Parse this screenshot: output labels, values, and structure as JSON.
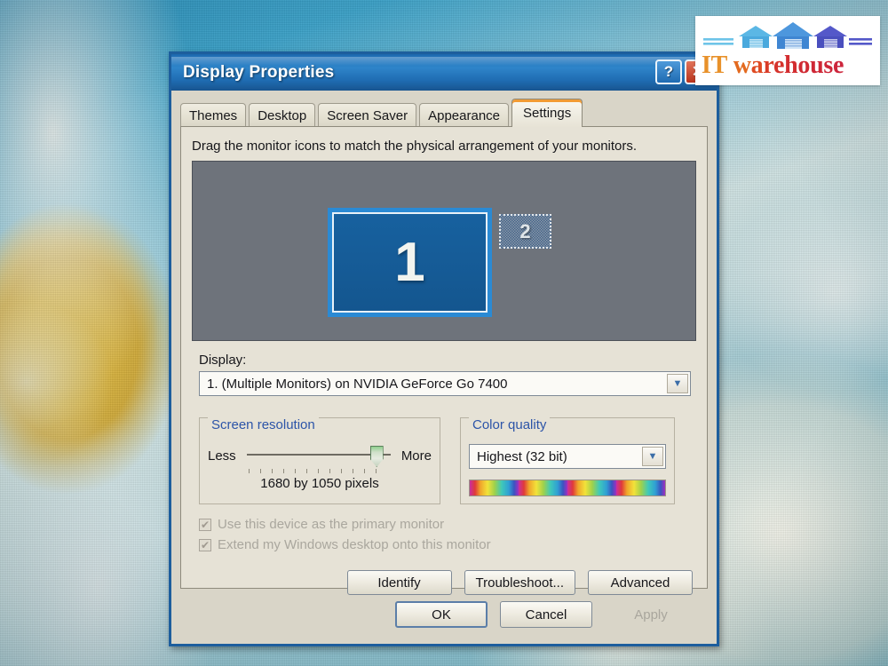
{
  "window": {
    "title": "Display Properties",
    "help_button": "?",
    "close_button": "✕"
  },
  "tabs": [
    {
      "label": "Themes",
      "active": false
    },
    {
      "label": "Desktop",
      "active": false
    },
    {
      "label": "Screen Saver",
      "active": false
    },
    {
      "label": "Appearance",
      "active": false
    },
    {
      "label": "Settings",
      "active": true
    }
  ],
  "settings": {
    "hint": "Drag the monitor icons to match the physical arrangement of your monitors.",
    "monitors": [
      {
        "number": "1",
        "selected": true
      },
      {
        "number": "2",
        "selected": false
      }
    ],
    "display_label": "Display:",
    "display_value": "1. (Multiple Monitors) on NVIDIA GeForce Go 7400",
    "screen_resolution": {
      "title": "Screen resolution",
      "less_label": "Less",
      "more_label": "More",
      "value": "1680 by 1050 pixels",
      "slider_percent": 92
    },
    "color_quality": {
      "title": "Color quality",
      "value": "Highest (32 bit)"
    },
    "checkboxes": [
      {
        "label": "Use this device as the primary monitor",
        "checked": true,
        "disabled": true
      },
      {
        "label": "Extend my Windows desktop onto this monitor",
        "checked": true,
        "disabled": true
      }
    ],
    "actions": [
      {
        "label": "Identify",
        "disabled": false
      },
      {
        "label": "Troubleshoot...",
        "disabled": false
      },
      {
        "label": "Advanced",
        "disabled": false
      }
    ]
  },
  "footer": {
    "ok": "OK",
    "cancel": "Cancel",
    "apply": "Apply",
    "apply_disabled": true
  },
  "watermark": {
    "text_it": "IT",
    "text_w": "w",
    "text_a": "a",
    "text_r": "r",
    "text_e1": "e",
    "text_h": "h",
    "text_o": "o",
    "text_u": "u",
    "text_s": "s",
    "text_e2": "e"
  },
  "colors": {
    "titlebar_blue": "#2577be",
    "window_border": "#1d5e9d",
    "dialog_face": "#e6e2d6",
    "group_title": "#2c54a8",
    "active_tab_accent": "#f29b34",
    "monitor_selected": "#17619f",
    "preview_bg": "#6e737b",
    "disabled_text": "#aaa79e"
  }
}
